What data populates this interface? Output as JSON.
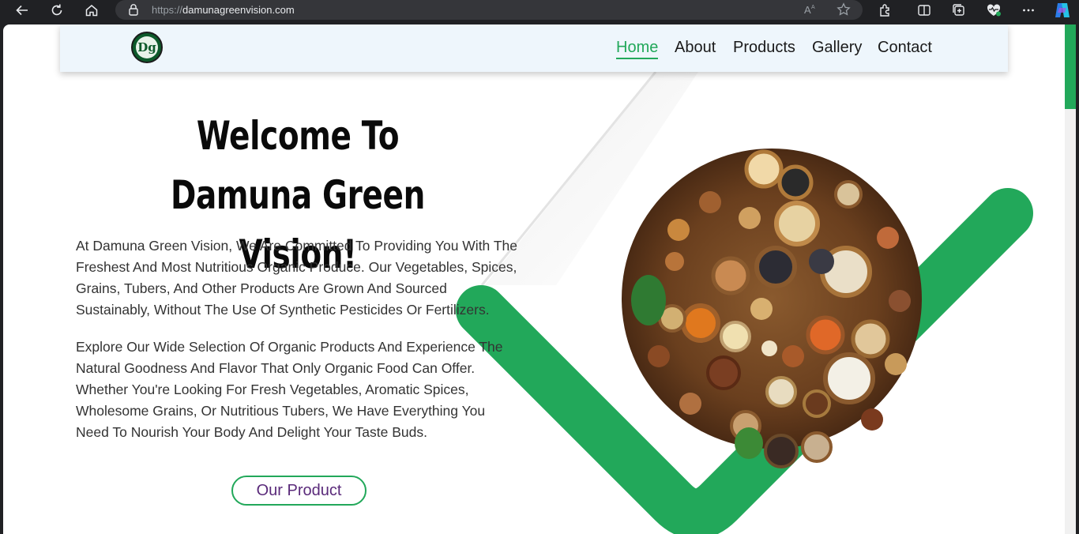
{
  "browser": {
    "url_prefix": "https://",
    "url_host": "damunagreenvision.com"
  },
  "nav": {
    "logo_text": "Dg",
    "items": [
      {
        "label": "Home",
        "active": true
      },
      {
        "label": "About",
        "active": false
      },
      {
        "label": "Products",
        "active": false
      },
      {
        "label": "Gallery",
        "active": false
      },
      {
        "label": "Contact",
        "active": false
      }
    ]
  },
  "hero": {
    "title_line1": "Welcome To Damuna Green",
    "title_line2": "Vision!",
    "paragraph1": "At Damuna Green Vision, We Are Committed To Providing You With The Freshest And Most Nutritious Organic Produce. Our Vegetables, Spices, Grains, Tubers, And Other Products Are Grown And Sourced Sustainably, Without The Use Of Synthetic Pesticides Or Fertilizers.",
    "paragraph2": "Explore Our Wide Selection Of Organic Products And Experience The Natural Goodness And Flavor That Only Organic Food Can Offer. Whether You're Looking For Fresh Vegetables, Aromatic Spices, Wholesome Grains, Or Nutritious Tubers, We Have Everything You Need To Nourish Your Body And Delight Your Taste Buds.",
    "cta_label": "Our Product"
  },
  "colors": {
    "brand_green": "#22a85a",
    "navbar_bg": "#eef6fc",
    "cta_text": "#5a2a7a"
  },
  "icons": [
    "back-icon",
    "refresh-icon",
    "home-icon",
    "lock-icon",
    "read-aloud-icon",
    "favorite-star-icon",
    "extensions-icon",
    "split-screen-icon",
    "collections-icon",
    "browser-essentials-icon",
    "more-icon",
    "copilot-icon"
  ]
}
